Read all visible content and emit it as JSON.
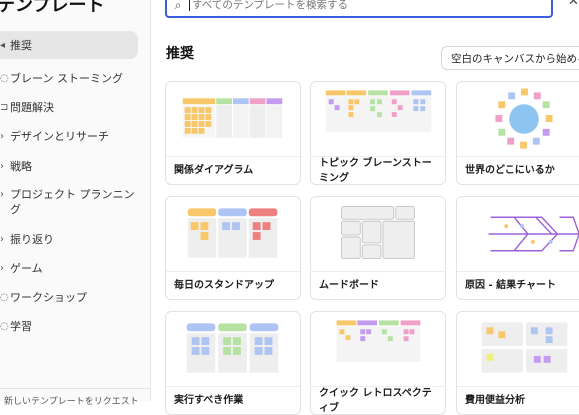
{
  "sidebar": {
    "title": "テンプレート",
    "items": [
      {
        "label": "推奨",
        "active": true
      },
      {
        "label": "ブレーン ストーミング"
      },
      {
        "label": "問題解決"
      },
      {
        "label": "デザインとリサーチ"
      },
      {
        "label": "戦略"
      },
      {
        "label": "プロジェクト プランニング"
      },
      {
        "label": "振り返り"
      },
      {
        "label": "ゲーム"
      },
      {
        "label": "ワークショップ"
      },
      {
        "label": "学習"
      }
    ],
    "footer": "新しいテンプレートをリクエスト"
  },
  "search": {
    "placeholder": "すべてのテンプレートを検索する",
    "value": ""
  },
  "section": {
    "title": "推奨",
    "blank_button": "空白のキャンバスから始める"
  },
  "templates": [
    {
      "label": "関係ダイアグラム"
    },
    {
      "label": "トピック ブレーンストーミング"
    },
    {
      "label": "世界のどこにいるか"
    },
    {
      "label": "毎日のスタンドアップ"
    },
    {
      "label": "ムードボード"
    },
    {
      "label": "原因 - 結果チャート"
    },
    {
      "label": "実行すべき作業"
    },
    {
      "label": "クイック レトロスペクティブ"
    },
    {
      "label": "費用便益分析"
    }
  ],
  "colors": {
    "accent": "#3d5ce0",
    "yellow": "#f7c76a",
    "green": "#b6e3a3",
    "blue": "#aec4f2",
    "pink": "#f0a0c8",
    "purple": "#c39cf0",
    "red": "#ee8080",
    "gray": "#e9e9e9"
  }
}
